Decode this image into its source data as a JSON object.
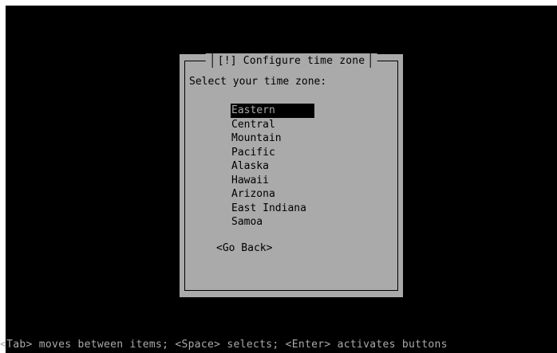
{
  "dialog": {
    "title": "[!] Configure time zone",
    "prompt": "Select your time zone:",
    "options": [
      "Eastern",
      "Central",
      "Mountain",
      "Pacific",
      "Alaska",
      "Hawaii",
      "Arizona",
      "East Indiana",
      "Samoa"
    ],
    "selected_index": 0,
    "go_back_label": "<Go Back>"
  },
  "status_bar": {
    "text": "<Tab> moves between items; <Space> selects; <Enter> activates buttons"
  },
  "colors": {
    "screen_background": "#000000",
    "dialog_background": "#aaaaaa",
    "text": "#000000",
    "highlight_background": "#000000",
    "highlight_text": "#aaaaaa",
    "status_text": "#aaaaaa"
  }
}
